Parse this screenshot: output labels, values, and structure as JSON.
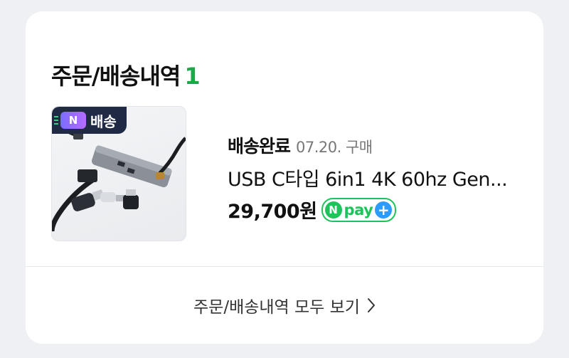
{
  "section": {
    "title": "주문/배송내역",
    "count": "1"
  },
  "order": {
    "badge": "배송",
    "badge_icon": "N",
    "status": "배송완료",
    "date": "07.20. 구매",
    "product_name": "USB C타입 6in1 4K 60hz Gen...",
    "price": "29,700원"
  },
  "npay": {
    "letter": "N",
    "text": "pay",
    "plus": "+"
  },
  "footer": {
    "link_label": "주문/배송내역 모두 보기"
  },
  "colors": {
    "accent_green": "#1aa84b",
    "npay_green": "#1fc35b",
    "npay_blue": "#2d9cff",
    "badge_bg": "#202a44"
  }
}
